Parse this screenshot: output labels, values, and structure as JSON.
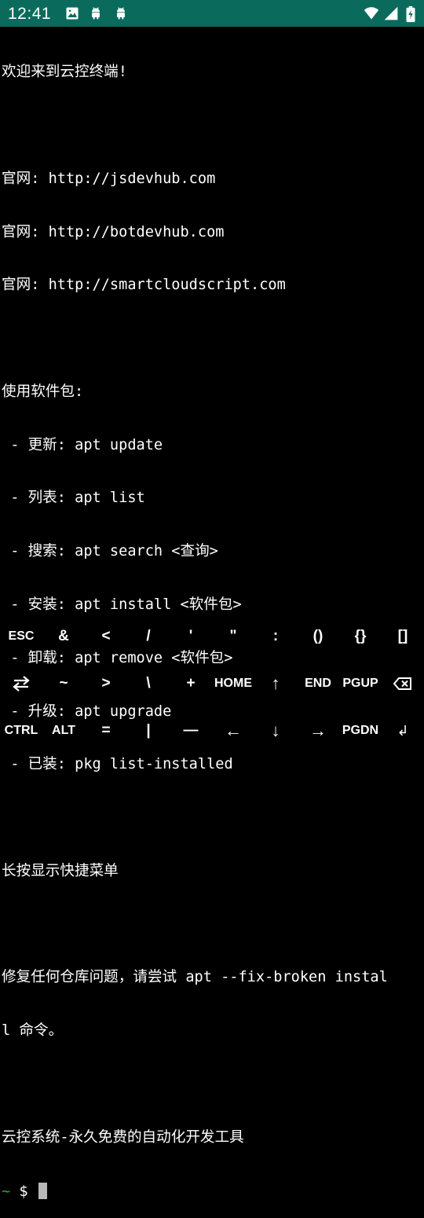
{
  "status_bar": {
    "time": "12:41",
    "background": "#0a6b5c",
    "left_icons": [
      "image-icon",
      "android-icon",
      "android-icon"
    ],
    "right_icons": [
      "wifi-icon",
      "signal-icon",
      "battery-icon"
    ]
  },
  "terminal": {
    "lines": [
      "欢迎来到云控终端!",
      "",
      "官网: http://jsdevhub.com",
      "官网: http://botdevhub.com",
      "官网: http://smartcloudscript.com",
      "",
      "使用软件包:",
      " - 更新: apt update",
      " - 列表: apt list",
      " - 搜索: apt search <查询>",
      " - 安装: apt install <软件包>",
      " - 卸载: apt remove <软件包>",
      " - 升级: apt upgrade",
      " - 已装: pkg list-installed",
      "",
      "长按显示快捷菜单",
      "",
      "修复任何仓库问题，请尝试 apt --fix-broken instal",
      "l 命令。",
      "",
      "云控系统-永久免费的自动化开发工具"
    ],
    "prompt_tilde": "~",
    "prompt_symbol": " $ ",
    "prompt_color": "#21b021"
  },
  "extra_keys": {
    "row1": [
      "ESC",
      "&",
      "<",
      "/",
      "'",
      "\"",
      ":",
      "()",
      "{}",
      "[]"
    ],
    "row2": [
      "",
      "~",
      ">",
      "\\",
      "+",
      "HOME",
      "↑",
      "END",
      "PGUP",
      ""
    ],
    "row3": [
      "CTRL",
      "ALT",
      "=",
      "|",
      "—",
      "←",
      "↓",
      "→",
      "PGDN",
      "↲"
    ]
  }
}
